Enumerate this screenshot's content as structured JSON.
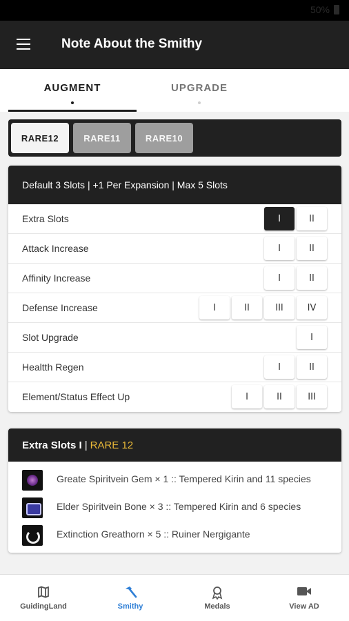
{
  "status_bar": {
    "battery": "50%"
  },
  "app_bar": {
    "title": "Note About the Smithy",
    "menu_icon": "menu-icon"
  },
  "tabs": [
    {
      "label": "AUGMENT",
      "selected": true
    },
    {
      "label": "UPGRADE",
      "selected": false
    }
  ],
  "rarity_tabs": [
    {
      "label": "RARE12",
      "selected": true
    },
    {
      "label": "RARE11",
      "selected": false
    },
    {
      "label": "RARE10",
      "selected": false
    }
  ],
  "slots_card": {
    "header": "Default 3 Slots | +1 Per Expansion | Max 5 Slots",
    "rows": [
      {
        "name": "Extra Slots",
        "levels": [
          "I",
          "II"
        ],
        "selected_level": "I"
      },
      {
        "name": "Attack Increase",
        "levels": [
          "I",
          "II"
        ]
      },
      {
        "name": "Affinity Increase",
        "levels": [
          "I",
          "II"
        ]
      },
      {
        "name": "Defense Increase",
        "levels": [
          "I",
          "II",
          "III",
          "IV"
        ]
      },
      {
        "name": "Slot Upgrade",
        "levels": [
          "I"
        ]
      },
      {
        "name": "Healtth Regen",
        "levels": [
          "I",
          "II"
        ]
      },
      {
        "name": "Element/Status Effect Up",
        "levels": [
          "I",
          "II",
          "III"
        ]
      }
    ]
  },
  "materials_card": {
    "title": "Extra Slots I",
    "separator": "|",
    "rarity": "RARE 12",
    "rarity_color": "#e8b838",
    "items": [
      {
        "icon": "gem-icon",
        "text": "Greate Spiritvein Gem × 1 :: Tempered Kirin and 11 species"
      },
      {
        "icon": "bone-icon",
        "text": "Elder Spiritvein Bone × 3 :: Tempered Kirin and 6 species"
      },
      {
        "icon": "horn-icon",
        "text": "Extinction Greathorn × 5 :: Ruiner Nergigante"
      }
    ]
  },
  "bottom_nav": [
    {
      "label": "GuidingLand",
      "icon": "map-icon",
      "active": false
    },
    {
      "label": "Smithy",
      "icon": "hammer-icon",
      "active": true,
      "color": "#2f7fd6"
    },
    {
      "label": "Medals",
      "icon": "medal-icon",
      "active": false
    },
    {
      "label": "View AD",
      "icon": "video-camera-icon",
      "active": false
    }
  ]
}
